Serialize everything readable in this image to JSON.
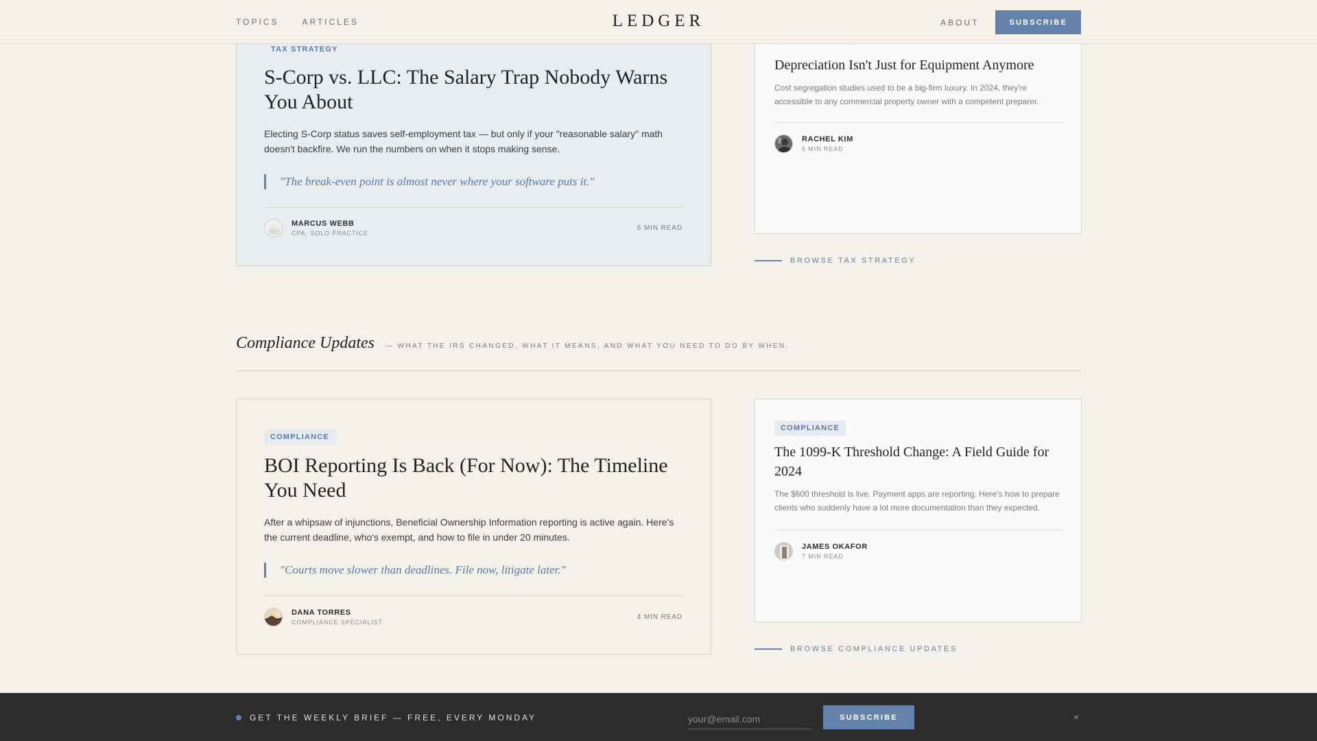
{
  "header": {
    "nav_left": [
      "TOPICS",
      "ARTICLES"
    ],
    "logo": "LEDGER",
    "nav_about": "ABOUT",
    "subscribe_label": "SUBSCRIBE"
  },
  "tax_section": {
    "feature": {
      "tag": "TAX STRATEGY",
      "title": "S-Corp vs. LLC: The Salary Trap Nobody Warns You About",
      "dek": "Electing S-Corp status saves self-employment tax — but only if your \"reasonable salary\" math doesn't backfire. We run the numbers on when it stops making sense.",
      "quote": "\"The break-even point is almost never where your software puts it.\"",
      "author": "MARCUS WEBB",
      "role": "CPA, SOLO PRACTICE",
      "read_time": "6 MIN READ"
    },
    "side": {
      "title": "Depreciation Isn't Just for Equipment Anymore",
      "dek": "Cost segregation studies used to be a big-firm luxury. In 2024, they're accessible to any commercial property owner with a competent preparer.",
      "author": "RACHEL KIM",
      "read_time": "5 MIN READ"
    },
    "browse": "BROWSE TAX STRATEGY"
  },
  "compliance_section": {
    "title": "Compliance Updates",
    "subtitle": "— WHAT THE IRS CHANGED, WHAT IT MEANS, AND WHAT YOU NEED TO DO BY WHEN.",
    "feature": {
      "tag": "COMPLIANCE",
      "title": "BOI Reporting Is Back (For Now): The Timeline You Need",
      "dek": "After a whipsaw of injunctions, Beneficial Ownership Information reporting is active again. Here's the current deadline, who's exempt, and how to file in under 20 minutes.",
      "quote": "\"Courts move slower than deadlines. File now, litigate later.\"",
      "author": "DANA TORRES",
      "role": "COMPLIANCE SPECIALIST",
      "read_time": "4 MIN READ"
    },
    "side": {
      "tag": "COMPLIANCE",
      "title": "The 1099-K Threshold Change: A Field Guide for 2024",
      "dek": "The $600 threshold is live. Payment apps are reporting. Here's how to prepare clients who suddenly have a lot more documentation than they expected.",
      "author": "JAMES OKAFOR",
      "read_time": "7 MIN READ"
    },
    "browse": "BROWSE COMPLIANCE UPDATES"
  },
  "newsletter": {
    "text": "GET THE WEEKLY BRIEF — FREE, EVERY MONDAY",
    "placeholder": "your@email.com",
    "button": "SUBSCRIBE",
    "close": "×"
  },
  "colors": {
    "accent": "#6483ac",
    "background": "#f4f1ea",
    "footer": "#2c2c2c"
  }
}
